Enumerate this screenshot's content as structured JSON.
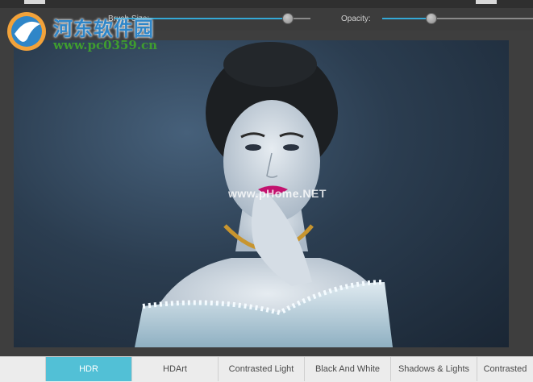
{
  "watermark": {
    "site_name": "河东软件园",
    "url": "www.pc0359.cn",
    "photo_watermark": "www.pHome.NET"
  },
  "options": {
    "brush_size_label": "Brush Size:",
    "brush_size_value": 0.77,
    "opacity_label": "Opacity:",
    "opacity_value": 0.33
  },
  "presets": {
    "tabs": [
      "HDR",
      "HDArt",
      "Contrasted Light",
      "Black And White",
      "Shadows & Lights",
      "Contrasted"
    ],
    "active": "HDR"
  },
  "colors": {
    "accent": "#34a8d6",
    "active_tab": "#52c0d6",
    "watermark_blue": "#2f86c8",
    "watermark_green": "#3f9d2f"
  }
}
